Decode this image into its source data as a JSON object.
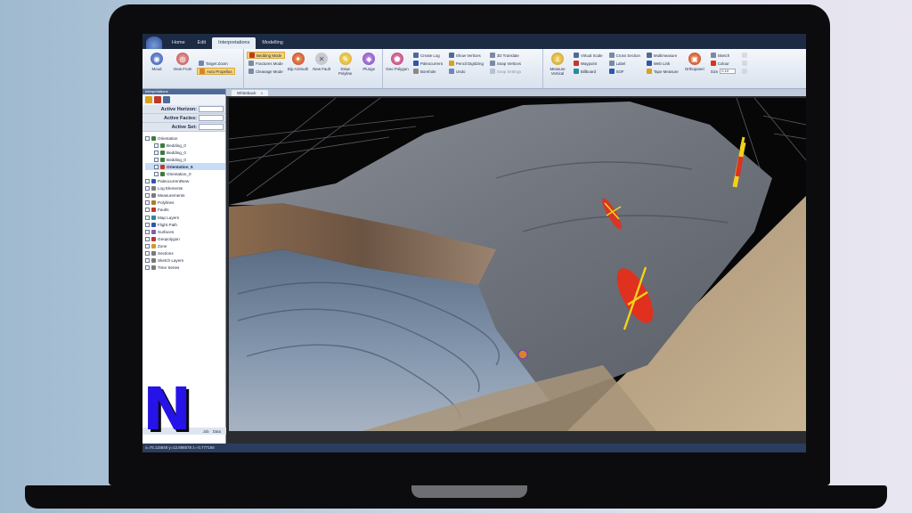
{
  "ribbon": {
    "tabs": [
      "Home",
      "Edit",
      "Interpretations",
      "Modelling"
    ],
    "active_tab": "Interpretations",
    "groups": {
      "view": {
        "mood_label": "Mood",
        "view_from_label": "View From",
        "target_zoom_label": "Target Zoom",
        "auto_propellus_label": "Auto Propellus"
      },
      "modes": {
        "bedding_mode_label": "Bedding Mode",
        "fractures_mode_label": "Fractures Mode",
        "cleavage_mode_label": "Cleavage Mode",
        "dip_azimuth_label": "Dip Azimuth",
        "new_fault_label": "New Fault",
        "draw_polyline_label": "Draw Polyline",
        "plunge_label": "Plunge"
      },
      "geo": {
        "geo_polygon_label": "Geo Polygon",
        "create_log_label": "Create Log",
        "paleocurrent_label": "Paleocurrent",
        "borehole_label": "Borehole",
        "show_vertices_label": "Show Vertices",
        "pencil_digitizing_label": "Pencil Digitizing",
        "undo_label": "Undo",
        "3d_translate_label": "3D Translate",
        "snap_vertices_label": "Snap Vertices",
        "snap_settings_label": "Snap Settings"
      },
      "measure": {
        "measure_vertical_label": "Measure Vertical",
        "virtual_scale_label": "Virtual Scale",
        "waypoint_label": "Waypoint",
        "billboard_label": "Billboard",
        "cross_section_label": "Cross Section",
        "label_label": "Label",
        "sof_label": "SOF",
        "multimeasure_label": "Multimeasure",
        "web_link_label": "Web Link",
        "tape_measure_label": "Tape Measure",
        "orthopanel_label": "Orthopanel",
        "sketch_label": "Sketch",
        "colour_label": "Colour",
        "size_label": "Size",
        "size_value": "0.10"
      }
    }
  },
  "sidepanel": {
    "title": "Interpretations",
    "active_horizon_label": "Active Horizon:",
    "active_facies_label": "Active Facies:",
    "active_set_label": "Active Set:",
    "tree": [
      {
        "label": "Orientation",
        "indent": 0,
        "bold": false,
        "color": "#3c7d3c"
      },
      {
        "label": "Bedding_0",
        "indent": 1,
        "bold": false,
        "color": "#3c7d3c"
      },
      {
        "label": "Bedding_0",
        "indent": 1,
        "bold": false,
        "color": "#3c7d3c"
      },
      {
        "label": "Bedding_0",
        "indent": 1,
        "bold": false,
        "color": "#3c7d3c"
      },
      {
        "label": "Orientation_5",
        "indent": 1,
        "bold": true,
        "color": "#c0392b"
      },
      {
        "label": "Orientation_0",
        "indent": 1,
        "bold": false,
        "color": "#3c7d3c"
      },
      {
        "label": "PaleocurrentNew",
        "indent": 0,
        "bold": false,
        "color": "#2c56b0"
      },
      {
        "label": "Log Elements",
        "indent": 0,
        "bold": false,
        "color": "#7a7a7a"
      },
      {
        "label": "Measurements",
        "indent": 0,
        "bold": false,
        "color": "#7a7a7a"
      },
      {
        "label": "Polylines",
        "indent": 0,
        "bold": false,
        "color": "#b07a2c"
      },
      {
        "label": "Faults",
        "indent": 0,
        "bold": false,
        "color": "#c0392b"
      },
      {
        "label": "Map Layers",
        "indent": 0,
        "bold": false,
        "color": "#2c8a9a"
      },
      {
        "label": "Flight Path",
        "indent": 0,
        "bold": false,
        "color": "#2c56b0"
      },
      {
        "label": "Surfaces",
        "indent": 0,
        "bold": false,
        "color": "#8a5ab0"
      },
      {
        "label": "Geopolygon",
        "indent": 0,
        "bold": false,
        "color": "#c0392b"
      },
      {
        "label": "Zone",
        "indent": 0,
        "bold": false,
        "color": "#d09a2c"
      },
      {
        "label": "Sections",
        "indent": 0,
        "bold": false,
        "color": "#7a7a7a"
      },
      {
        "label": "Sketch Layers",
        "indent": 0,
        "bold": false,
        "color": "#7a7a7a"
      },
      {
        "label": "Time Series",
        "indent": 0,
        "bold": false,
        "color": "#7a7a7a"
      }
    ],
    "bottom_tabs": [
      "Job",
      "Data"
    ]
  },
  "viewport": {
    "tab_label": "Whiteback",
    "tab_close": "x"
  },
  "statusbar": {
    "text": "x=76.115848 y=12.898578 z=-0.777166"
  },
  "logo": {
    "letter": "N"
  },
  "colors": {
    "accent_red": "#e0301e",
    "accent_yellow": "#f2d21a",
    "logo_blue": "#2613e8"
  }
}
